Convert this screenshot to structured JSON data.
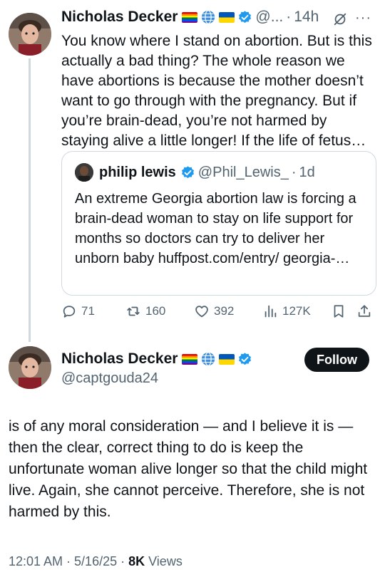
{
  "tweet1": {
    "name": "Nicholas Decker",
    "handle": "@...",
    "time": "14h",
    "text": "You know where I stand on abortion. But is this actually a bad thing? The whole reason we have abortions is because the mother doesn’t want to go through with the pregnancy. But if you’re brain-dead, you’re not harmed by staying alive a little longer! If the life of fetus…",
    "icons": [
      "rainbow-flag-icon",
      "globe-icon",
      "ukraine-flag-icon",
      "verified-badge-icon",
      "mute-icon",
      "more-icon"
    ]
  },
  "quote": {
    "name": "philip lewis",
    "handle": "@Phil_Lewis_",
    "time": "1d",
    "text": "An extreme Georgia abortion law is forcing a brain-dead woman to stay on life support for months so doctors can try to deliver her unborn baby huffpost.com/entry/ georgia-…"
  },
  "actions": {
    "replies": "71",
    "retweets": "160",
    "likes": "392",
    "views": "127K"
  },
  "tweet2": {
    "name": "Nicholas Decker",
    "handle": "@captgouda24",
    "follow_label": "Follow",
    "text": "is of any moral consideration — and I believe it is — then the clear, correct thing to do is keep the unfortunate woman alive longer so that the child might live. Again, she cannot perceive. Therefore, she is not harmed by this.",
    "timestamp": "12:01 AM · 5/16/25 · ",
    "views_count": "8K",
    "views_label": " Views"
  },
  "colors": {
    "text": "#0f1419",
    "secondary": "#536471",
    "verified": "#1d9bf0",
    "border": "#cfd9de"
  }
}
